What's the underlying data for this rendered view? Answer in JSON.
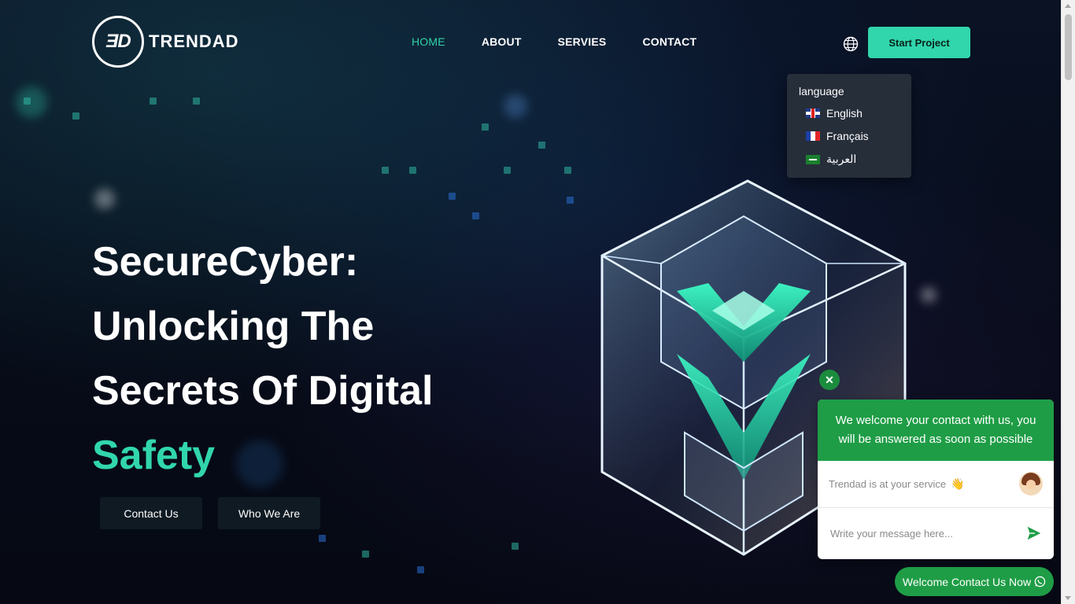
{
  "brand": {
    "mark": "ƎD",
    "name": "TRENDAD"
  },
  "nav": {
    "items": [
      {
        "label": "HOME",
        "active": true
      },
      {
        "label": "ABOUT",
        "active": false
      },
      {
        "label": "SERVIES",
        "active": false
      },
      {
        "label": "CONTACT",
        "active": false
      }
    ]
  },
  "header": {
    "cta_label": "Start Project",
    "globe_icon": "globe-icon"
  },
  "language_menu": {
    "title": "language",
    "options": [
      {
        "label": "English",
        "flag": "uk-flag-icon"
      },
      {
        "label": "Français",
        "flag": "france-flag-icon"
      },
      {
        "label": "العربية",
        "flag": "saudi-flag-icon"
      }
    ]
  },
  "hero": {
    "line1": "SecureCyber:",
    "line2": "Unlocking The",
    "line3": "Secrets Of Digital",
    "accent": "Safety",
    "buttons": [
      "Contact Us",
      "Who We Are"
    ]
  },
  "chat": {
    "close_symbol": "✕",
    "header": "We welcome your contact with us, you will be answered as soon as possible",
    "agent_text": "Trendad is at your service",
    "wave_emoji": "👋",
    "input_placeholder": "Write your message here...",
    "cta_label": "Welcome Contact Us Now"
  },
  "colors": {
    "accent": "#31d6ac",
    "chat_green": "#1f9d46",
    "background": "#070b18"
  }
}
